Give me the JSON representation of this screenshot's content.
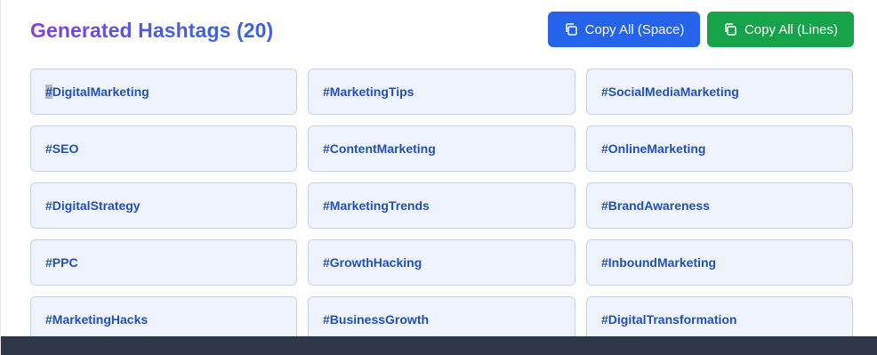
{
  "header": {
    "title": "Generated Hashtags (20)",
    "copy_space_label": "Copy All (Space)",
    "copy_lines_label": "Copy All (Lines)",
    "copy_icon": "copy-icon"
  },
  "hashtags": [
    "#DigitalMarketing",
    "#MarketingTips",
    "#SocialMediaMarketing",
    "#SEO",
    "#ContentMarketing",
    "#OnlineMarketing",
    "#DigitalStrategy",
    "#MarketingTrends",
    "#BrandAwareness",
    "#PPC",
    "#GrowthHacking",
    "#InboundMarketing",
    "#MarketingHacks",
    "#BusinessGrowth",
    "#DigitalTransformation"
  ],
  "colors": {
    "title_gradient_start": "#8b3be0",
    "title_gradient_end": "#3a62dd",
    "copy_space_button": "#2563eb",
    "copy_lines_button": "#16a34a",
    "tag_background": "#eef3fd",
    "tag_border": "#c3d4f1",
    "tag_text": "#2350b8",
    "footer_bar": "#2d3748"
  }
}
